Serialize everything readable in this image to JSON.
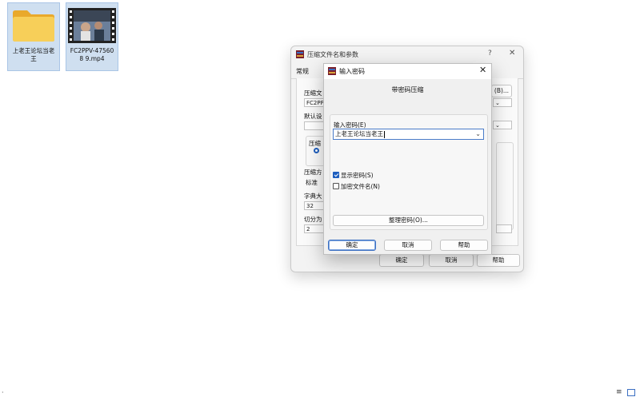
{
  "desktop": {
    "icons": [
      {
        "label": "上老王论坛当老王",
        "type": "folder"
      },
      {
        "label": "FC2PPV-475608 9.mp4",
        "type": "video"
      }
    ]
  },
  "parent_dialog": {
    "title": "压缩文件名和参数",
    "help": "?",
    "close": "✕",
    "tab": "常规",
    "labels": {
      "archive_name": "压缩文",
      "archive_value": "FC2PP",
      "default_set": "默认设",
      "format_group": "压缩",
      "method": "压缩方",
      "method_value": "标准",
      "dict": "字典大",
      "dict_value": "32",
      "split": "切分为",
      "split_value": "2",
      "browse": "(B)..."
    },
    "buttons": {
      "ok": "确定",
      "cancel": "取消",
      "help": "帮助"
    }
  },
  "password_dialog": {
    "title": "输入密码",
    "close": "✕",
    "heading": "带密码压缩",
    "input_label": "输入密码(E)",
    "input_value": "上老王论坛当老王",
    "show_password": {
      "label": "显示密码(S)",
      "checked": true
    },
    "encrypt_names": {
      "label": "加密文件名(N)",
      "checked": false
    },
    "organize_button": "整理密码(O)...",
    "buttons": {
      "ok": "确定",
      "cancel": "取消",
      "help": "帮助"
    }
  },
  "colors": {
    "accent": "#1f5fbf",
    "selection": "#cfdff0"
  }
}
